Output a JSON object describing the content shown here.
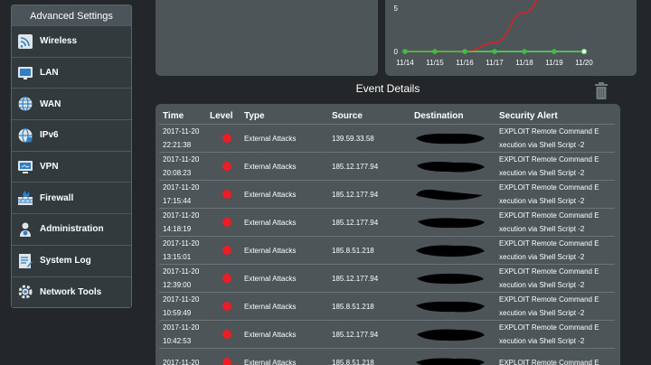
{
  "sidebar": {
    "title": "Advanced Settings",
    "items": [
      {
        "label": "Wireless",
        "icon": "wireless-icon"
      },
      {
        "label": "LAN",
        "icon": "lan-icon"
      },
      {
        "label": "WAN",
        "icon": "globe-icon"
      },
      {
        "label": "IPv6",
        "icon": "ipv6-globe-icon"
      },
      {
        "label": "VPN",
        "icon": "vpn-monitor-icon"
      },
      {
        "label": "Firewall",
        "icon": "firewall-icon"
      },
      {
        "label": "Administration",
        "icon": "administration-icon"
      },
      {
        "label": "System Log",
        "icon": "system-log-icon"
      },
      {
        "label": "Network Tools",
        "icon": "network-tools-icon"
      }
    ]
  },
  "chart_data": {
    "type": "line",
    "categories": [
      "11/14",
      "11/15",
      "11/16",
      "11/17",
      "11/18",
      "11/19",
      "11/20"
    ],
    "series": [
      {
        "values": [
          0,
          0,
          0,
          0,
          0,
          0,
          0
        ],
        "color": "#3fbf3f"
      },
      {
        "values": [
          0,
          0,
          0,
          1,
          4.5,
          9,
          14
        ],
        "color": "#e02020"
      }
    ],
    "y_ticks_visible": [
      "5",
      "0"
    ],
    "ylim": [
      0,
      7
    ]
  },
  "events": {
    "title": "Event Details",
    "columns": {
      "time": "Time",
      "level": "Level",
      "type": "Type",
      "source": "Source",
      "destination": "Destination",
      "alert": "Security Alert"
    },
    "rows": [
      {
        "date": "2017-11-20",
        "clock": "22:21:38",
        "type": "External Attacks",
        "source": "139.59.33.58",
        "alert1": "EXPLOIT Remote Command E",
        "alert2": "xecution via Shell Script -2"
      },
      {
        "date": "2017-11-20",
        "clock": "20:08:23",
        "type": "External Attacks",
        "source": "185.12.177.94",
        "alert1": "EXPLOIT Remote Command E",
        "alert2": "xecution via Shell Script -2"
      },
      {
        "date": "2017-11-20",
        "clock": "17:15:44",
        "type": "External Attacks",
        "source": "185.12.177.94",
        "alert1": "EXPLOIT Remote Command E",
        "alert2": "xecution via Shell Script -2"
      },
      {
        "date": "2017-11-20",
        "clock": "14:18:19",
        "type": "External Attacks",
        "source": "185.12.177.94",
        "alert1": "EXPLOIT Remote Command E",
        "alert2": "xecution via Shell Script -2"
      },
      {
        "date": "2017-11-20",
        "clock": "13:15:01",
        "type": "External Attacks",
        "source": "185.8.51.218",
        "alert1": "EXPLOIT Remote Command E",
        "alert2": "xecution via Shell Script -2"
      },
      {
        "date": "2017-11-20",
        "clock": "12:39:00",
        "type": "External Attacks",
        "source": "185.12.177.94",
        "alert1": "EXPLOIT Remote Command E",
        "alert2": "xecution via Shell Script -2"
      },
      {
        "date": "2017-11-20",
        "clock": "10:59:49",
        "type": "External Attacks",
        "source": "185.8.51.218",
        "alert1": "EXPLOIT Remote Command E",
        "alert2": "xecution via Shell Script -2"
      },
      {
        "date": "2017-11-20",
        "clock": "10:42:53",
        "type": "External Attacks",
        "source": "185.12.177.94",
        "alert1": "EXPLOIT Remote Command E",
        "alert2": "xecution via Shell Script -2"
      },
      {
        "date": "2017-11-20",
        "clock": "",
        "type": "External Attacks",
        "source": "185.8.51.218",
        "alert1": "EXPLOIT Remote Command E",
        "alert2": ""
      }
    ],
    "level_color": "#ee1c25"
  }
}
